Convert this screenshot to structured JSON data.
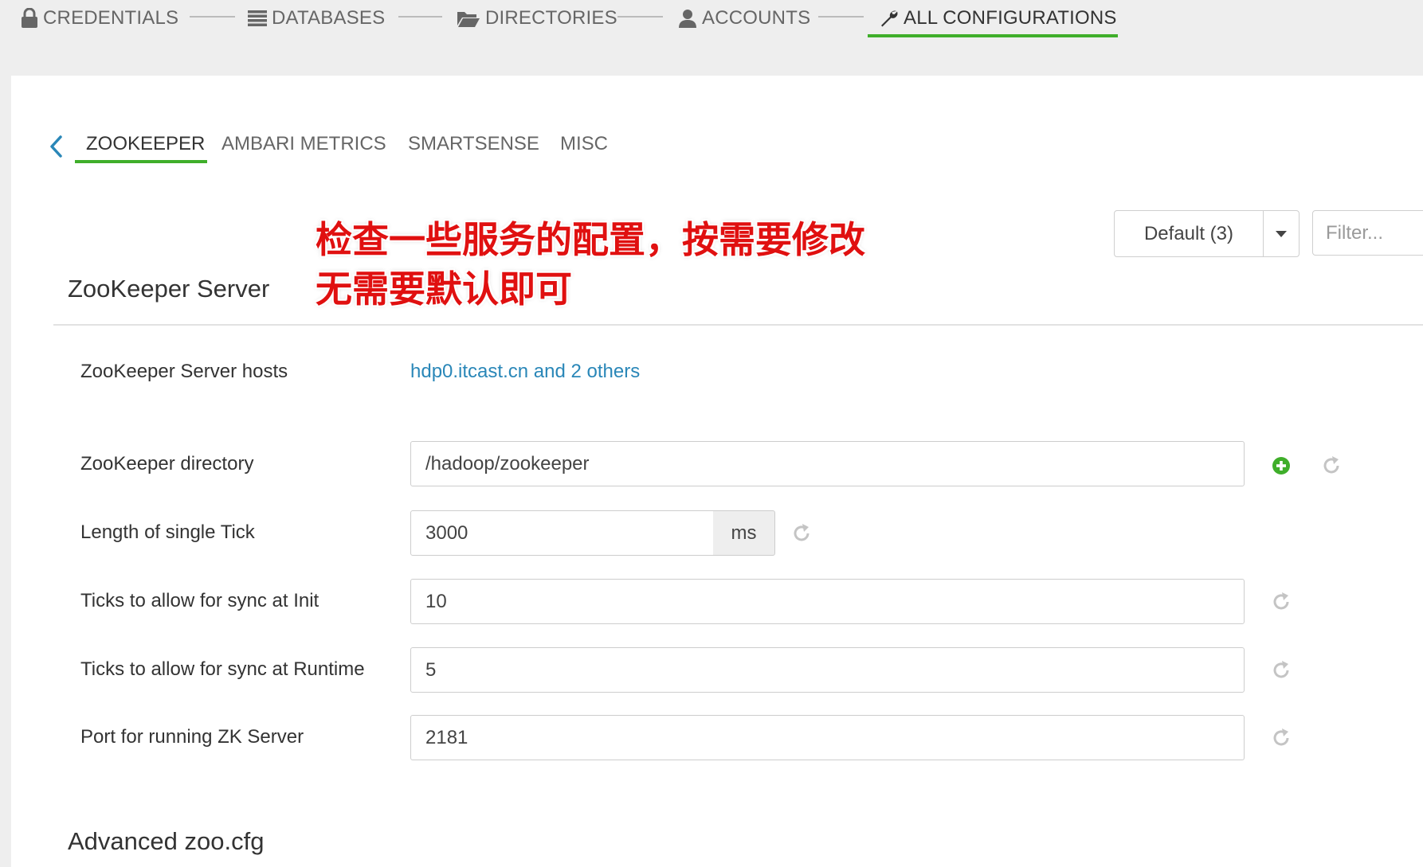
{
  "colors": {
    "accent_green": "#3fae2a",
    "link_blue": "#2a87b8",
    "annotation_red": "#e01010",
    "icon_grey": "#c4c4c4"
  },
  "wizard": {
    "steps": [
      {
        "label": "CREDENTIALS",
        "icon": "lock-icon"
      },
      {
        "label": "DATABASES",
        "icon": "list-icon"
      },
      {
        "label": "DIRECTORIES",
        "icon": "folder-open-icon"
      },
      {
        "label": "ACCOUNTS",
        "icon": "user-icon"
      },
      {
        "label": "ALL CONFIGURATIONS",
        "icon": "wrench-icon",
        "active": true
      }
    ]
  },
  "tabs": {
    "items": [
      {
        "label": "ZOOKEEPER",
        "active": true
      },
      {
        "label": "AMBARI METRICS"
      },
      {
        "label": "SMARTSENSE"
      },
      {
        "label": "MISC"
      }
    ]
  },
  "toolbar": {
    "config_group": "Default (3)",
    "filter_placeholder": "Filter..."
  },
  "annotation": {
    "line1": "检查一些服务的配置，按需要修改",
    "line2": "无需要默认即可"
  },
  "section": {
    "title": "ZooKeeper Server",
    "hosts_label": "ZooKeeper Server hosts",
    "hosts_value": "hdp0.itcast.cn and 2 others",
    "fields": [
      {
        "label": "ZooKeeper directory",
        "value": "/hadoop/zookeeper"
      },
      {
        "label": "Length of single Tick",
        "value": "3000",
        "unit": "ms"
      },
      {
        "label": "Ticks to allow for sync at Init",
        "value": "10"
      },
      {
        "label": "Ticks to allow for sync at Runtime",
        "value": "5"
      },
      {
        "label": "Port for running ZK Server",
        "value": "2181"
      }
    ]
  },
  "advanced_section": {
    "title": "Advanced zoo.cfg"
  }
}
